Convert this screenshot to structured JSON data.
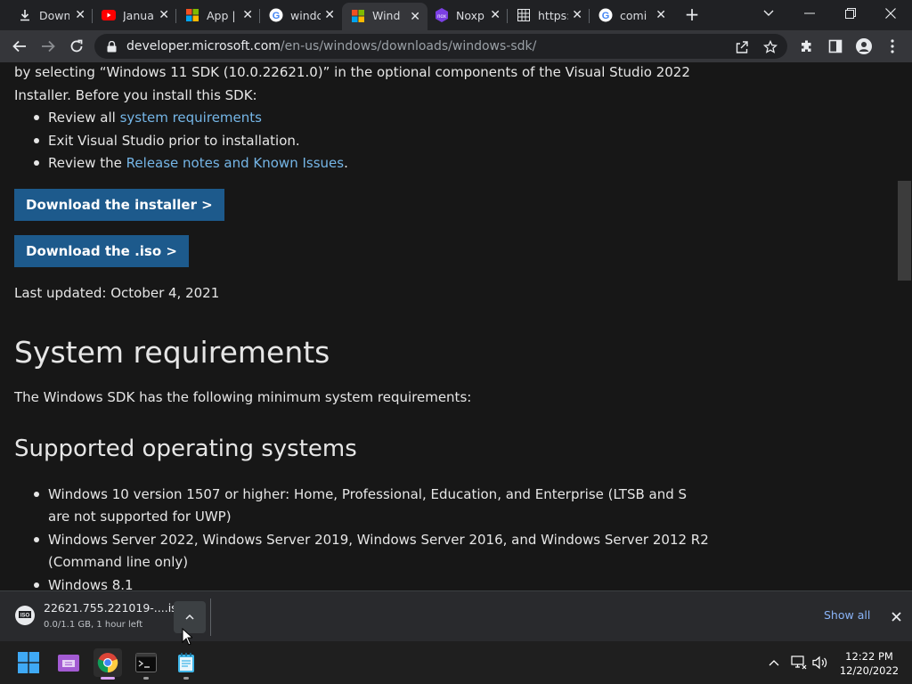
{
  "tabs": [
    {
      "title": "Down",
      "icon": "download-icon",
      "active": false
    },
    {
      "title": "Janua",
      "icon": "youtube-icon",
      "active": false
    },
    {
      "title": "App |",
      "icon": "microsoft-logo-icon",
      "active": false
    },
    {
      "title": "windc",
      "icon": "google-icon",
      "active": false
    },
    {
      "title": "Wind",
      "icon": "microsoft-logo-icon",
      "active": true
    },
    {
      "title": "Noxp",
      "icon": "noxplayer-icon",
      "active": false
    },
    {
      "title": "https:",
      "icon": "grid-favicon-icon",
      "active": false
    },
    {
      "title": "comi",
      "icon": "google-icon",
      "active": false
    }
  ],
  "address": {
    "host": "developer.microsoft.com",
    "path": "/en-us/windows/downloads/windows-sdk/"
  },
  "content": {
    "intro_line1": "by selecting “Windows 11 SDK (10.0.22621.0)” in the optional components of the Visual Studio 2022",
    "intro_line2": "Installer. Before you install this SDK:",
    "bullet1_prefix": "Review all ",
    "bullet1_link": "system requirements",
    "bullet2": "Exit Visual Studio prior to installation.",
    "bullet3_prefix": "Review the ",
    "bullet3_link": "Release notes and Known Issues",
    "bullet3_suffix": ".",
    "btn_installer": "Download the installer >",
    "btn_iso": "Download the .iso >",
    "last_updated": "Last updated: October 4, 2021",
    "h_sysreq": "System requirements",
    "sysreq_desc": "The Windows SDK has the following minimum system requirements:",
    "h_supported_os": "Supported operating systems",
    "os_items": [
      {
        "line1": "Windows 10 version 1507 or higher: Home, Professional, Education, and Enterprise (LTSB and S",
        "line2": "are not supported for UWP)"
      },
      {
        "line1": "Windows Server 2022, Windows Server 2019, Windows Server 2016, and Windows Server 2012 R2",
        "line2": "(Command line only)"
      },
      {
        "line1": "Windows 8.1",
        "line2": ""
      }
    ]
  },
  "download_shelf": {
    "filename": "22621.755.221019-....iso",
    "status": "0.0/1.1 GB, 1 hour left",
    "file_icon_label": "ISO",
    "show_all": "Show all"
  },
  "taskbar": {
    "apps": [
      "windows-start-icon",
      "file-explorer-icon",
      "chrome-icon",
      "terminal-icon",
      "notepad-icon"
    ],
    "time": "12:22 PM",
    "date": "12/20/2022"
  },
  "colors": {
    "link": "#75b6e7",
    "button_bg": "#1d5a8c",
    "page_bg": "#171717"
  }
}
